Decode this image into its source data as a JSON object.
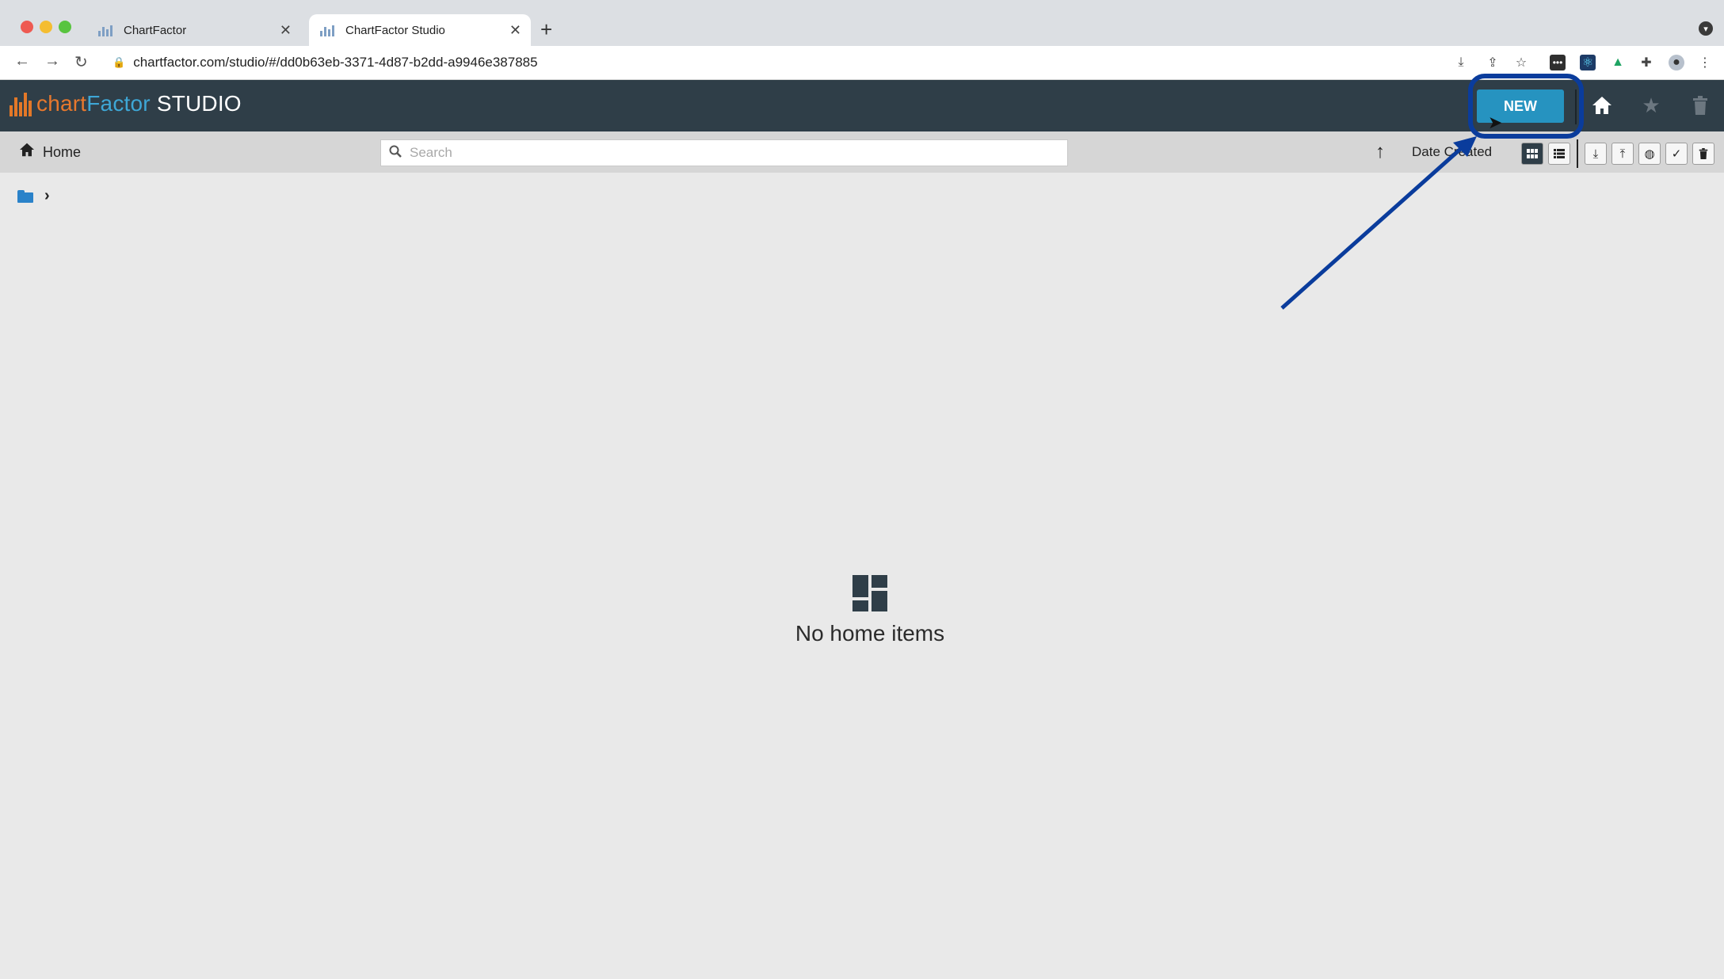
{
  "browser": {
    "tabs": [
      {
        "title": "ChartFactor",
        "active": false
      },
      {
        "title": "ChartFactor Studio",
        "active": true
      }
    ],
    "url": "chartfactor.com/studio/#/dd0b63eb-3371-4d87-b2dd-a9946e387885"
  },
  "app": {
    "logo": {
      "part1": "chart",
      "part2": "Factor",
      "part3": "STUDIO"
    },
    "new_button": "NEW",
    "toolbar": {
      "home_label": "Home",
      "search_placeholder": "Search",
      "sort_label": "Date Created"
    },
    "empty_state": {
      "text": "No home items"
    }
  },
  "colors": {
    "header_bg": "#2f3e48",
    "new_button": "#2693c0",
    "logo_orange": "#e7782d",
    "logo_blue": "#3ea7d6",
    "annotation": "#0a3c9c",
    "folder": "#2a82c9"
  }
}
